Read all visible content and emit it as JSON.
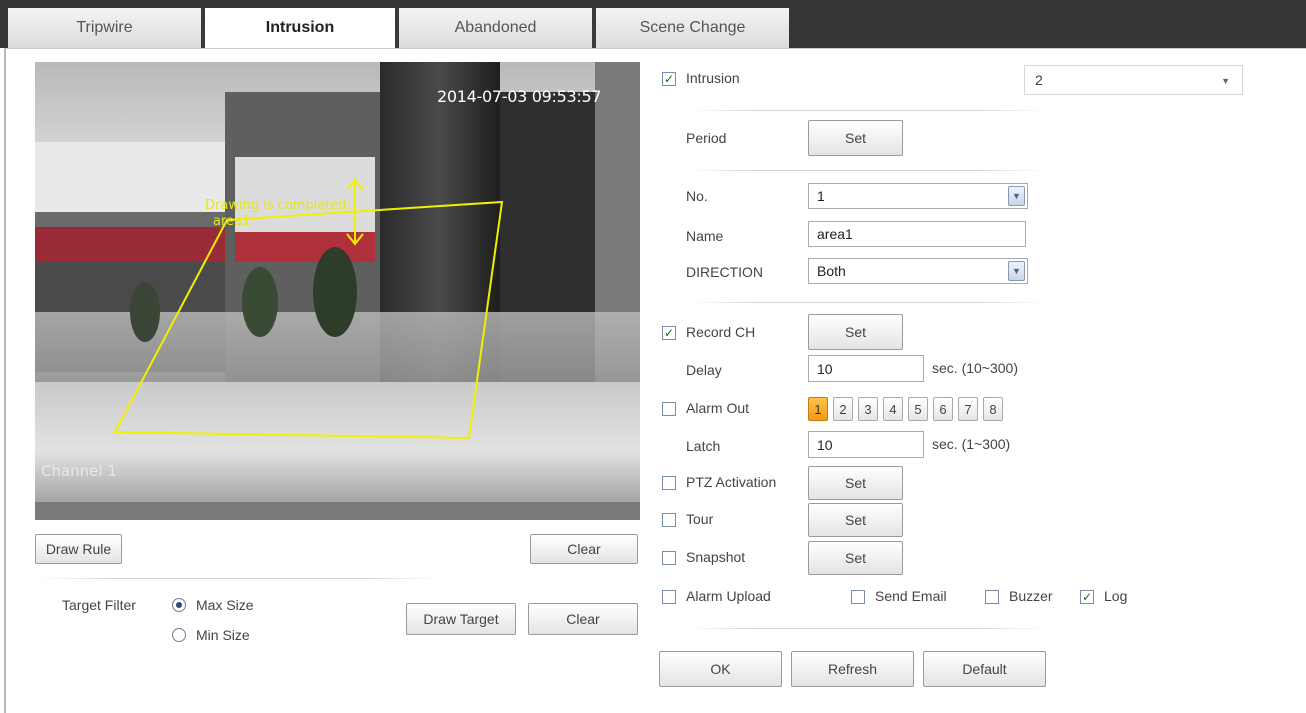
{
  "tabs": [
    {
      "label": "Tripwire",
      "active": false
    },
    {
      "label": "Intrusion",
      "active": true
    },
    {
      "label": "Abandoned",
      "active": false
    },
    {
      "label": "Scene Change",
      "active": false
    }
  ],
  "video": {
    "timestamp": "2014-07-03 09:53:57",
    "channel": "Channel 1",
    "hint_line1": "Drawing is completed:",
    "hint_line2": "area1"
  },
  "left_controls": {
    "draw_rule": "Draw Rule",
    "clear_rule": "Clear",
    "target_filter_label": "Target Filter",
    "max_size": "Max Size",
    "min_size": "Min Size",
    "selected_size": "Max Size",
    "draw_target": "Draw Target",
    "clear_target": "Clear"
  },
  "settings": {
    "intrusion": {
      "label": "Intrusion",
      "checked": true
    },
    "channel_select": "2",
    "period": {
      "label": "Period",
      "button": "Set"
    },
    "no": {
      "label": "No.",
      "value": "1"
    },
    "name": {
      "label": "Name",
      "value": "area1"
    },
    "direction": {
      "label": "DIRECTION",
      "value": "Both"
    },
    "record_ch": {
      "label": "Record CH",
      "checked": true,
      "button": "Set"
    },
    "delay": {
      "label": "Delay",
      "value": "10",
      "unit": "sec. (10~300)"
    },
    "alarm_out": {
      "label": "Alarm Out",
      "checked": false,
      "channels": [
        "1",
        "2",
        "3",
        "4",
        "5",
        "6",
        "7",
        "8"
      ],
      "selected": "1"
    },
    "latch": {
      "label": "Latch",
      "value": "10",
      "unit": "sec. (1~300)"
    },
    "ptz_activation": {
      "label": "PTZ Activation",
      "checked": false,
      "button": "Set"
    },
    "tour": {
      "label": "Tour",
      "checked": false,
      "button": "Set"
    },
    "snapshot": {
      "label": "Snapshot",
      "checked": false,
      "button": "Set"
    },
    "alarm_upload": {
      "label": "Alarm Upload",
      "checked": false
    },
    "send_email": {
      "label": "Send Email",
      "checked": false
    },
    "buzzer": {
      "label": "Buzzer",
      "checked": false
    },
    "log": {
      "label": "Log",
      "checked": true
    }
  },
  "footer": {
    "ok": "OK",
    "refresh": "Refresh",
    "default": "Default"
  },
  "colors": {
    "active_channel": "#f5a21f",
    "drawing_line": "#f0f000",
    "tab_bar": "#353535"
  }
}
